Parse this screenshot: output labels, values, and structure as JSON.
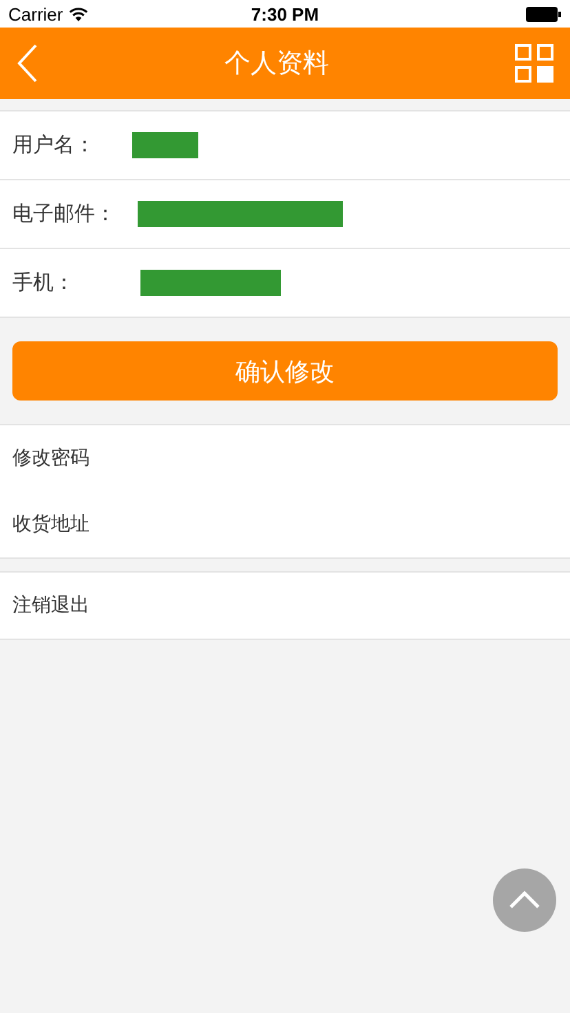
{
  "status_bar": {
    "carrier": "Carrier",
    "time": "7:30 PM"
  },
  "nav_bar": {
    "title": "个人资料"
  },
  "profile_fields": [
    {
      "label": "用户名：",
      "redacted": true
    },
    {
      "label": "电子邮件：",
      "redacted": true
    },
    {
      "label": "手机：",
      "redacted": true
    }
  ],
  "confirm_button": "确认修改",
  "menu_groups": [
    [
      "修改密码",
      "收货地址"
    ],
    [
      "注销退出"
    ]
  ]
}
